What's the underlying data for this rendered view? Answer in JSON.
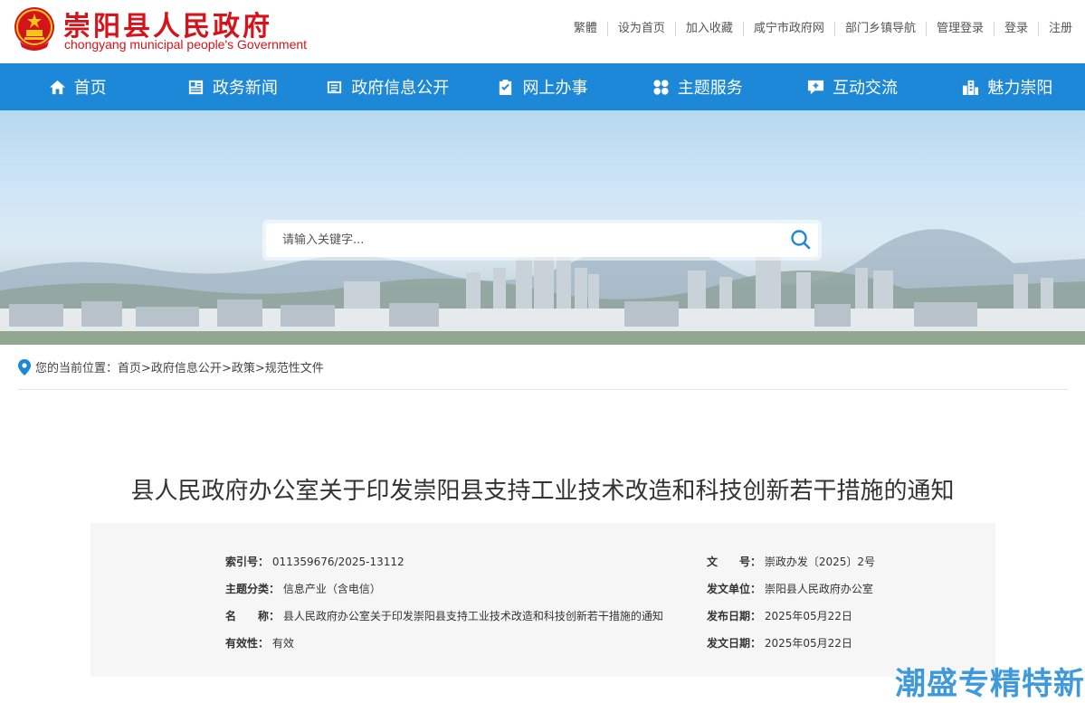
{
  "header": {
    "site_name": "崇阳县人民政府",
    "site_name_en": "chongyang municipal people's Government",
    "top_links": [
      "繁體",
      "设为首页",
      "加入收藏",
      "咸宁市政府网",
      "部门乡镇导航",
      "管理登录",
      "登录",
      "注册"
    ]
  },
  "nav": [
    {
      "label": "首页",
      "icon": "home-icon"
    },
    {
      "label": "政务新闻",
      "icon": "news-icon"
    },
    {
      "label": "政府信息公开",
      "icon": "list-icon"
    },
    {
      "label": "网上办事",
      "icon": "clipboard-check-icon"
    },
    {
      "label": "主题服务",
      "icon": "grid-icon"
    },
    {
      "label": "互动交流",
      "icon": "chat-icon"
    },
    {
      "label": "魅力崇阳",
      "icon": "building-icon"
    }
  ],
  "search": {
    "placeholder": "请输入关键字...",
    "icon": "search-icon"
  },
  "breadcrumb": {
    "prefix": "您的当前位置：",
    "items": [
      "首页",
      ">政府信息公开",
      ">政策",
      ">规范性文件"
    ]
  },
  "document": {
    "title": "县人民政府办公室关于印发崇阳县支持工业技术改造和科技创新若干措施的通知",
    "fields": {
      "index_label": "索引号：",
      "index_value": "011359676/2025-13112",
      "docno_label": "文　　号：",
      "docno_value": "崇政办发〔2025〕2号",
      "topic_label": "主题分类：",
      "topic_value": "信息产业（含电信）",
      "issuer_label": "发文单位：",
      "issuer_value": "崇阳县人民政府办公室",
      "name_label": "名　　称：",
      "name_value": "县人民政府办公室关于印发崇阳县支持工业技术改造和科技创新若干措施的通知",
      "publish_label": "发布日期：",
      "publish_value": "2025年05月22日",
      "validity_label": "有效性：",
      "validity_value": "有效",
      "issue_date_label": "发文日期：",
      "issue_date_value": "2025年05月22日"
    }
  },
  "watermark": "潮盛专精特新",
  "colors": {
    "brand_red": "#d4141a",
    "nav_blue": "#1e88d8"
  }
}
